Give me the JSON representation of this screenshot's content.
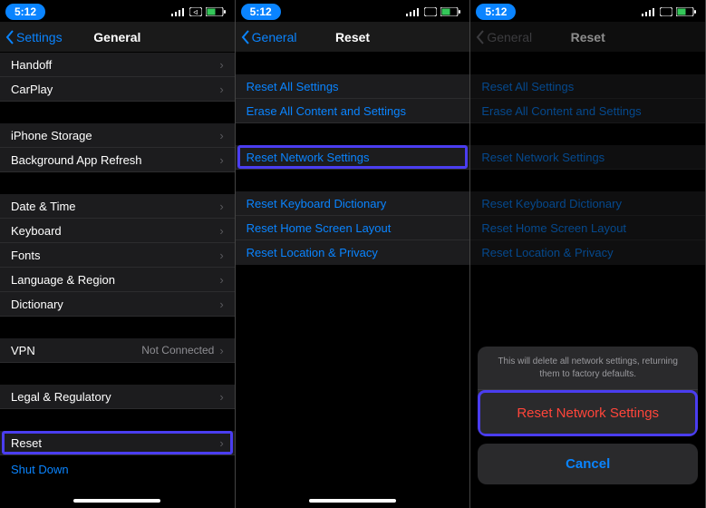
{
  "status": {
    "time": "5:12"
  },
  "p1": {
    "back": "Settings",
    "title": "General",
    "s1": [
      {
        "label": "Handoff"
      },
      {
        "label": "CarPlay"
      }
    ],
    "s2": [
      {
        "label": "iPhone Storage"
      },
      {
        "label": "Background App Refresh"
      }
    ],
    "s3": [
      {
        "label": "Date & Time"
      },
      {
        "label": "Keyboard"
      },
      {
        "label": "Fonts"
      },
      {
        "label": "Language & Region"
      },
      {
        "label": "Dictionary"
      }
    ],
    "s4": [
      {
        "label": "VPN",
        "detail": "Not Connected"
      }
    ],
    "s5": [
      {
        "label": "Legal & Regulatory"
      }
    ],
    "s6": [
      {
        "label": "Reset",
        "hl": true
      }
    ],
    "shutdown": "Shut Down"
  },
  "p2": {
    "back": "General",
    "title": "Reset",
    "s1": [
      {
        "label": "Reset All Settings"
      },
      {
        "label": "Erase All Content and Settings"
      }
    ],
    "s2": [
      {
        "label": "Reset Network Settings",
        "hl": true
      }
    ],
    "s3": [
      {
        "label": "Reset Keyboard Dictionary"
      },
      {
        "label": "Reset Home Screen Layout"
      },
      {
        "label": "Reset Location & Privacy"
      }
    ]
  },
  "p3": {
    "back": "General",
    "title": "Reset",
    "sheet": {
      "msg": "This will delete all network settings, returning them to factory defaults.",
      "destructive": "Reset Network Settings",
      "cancel": "Cancel"
    }
  }
}
